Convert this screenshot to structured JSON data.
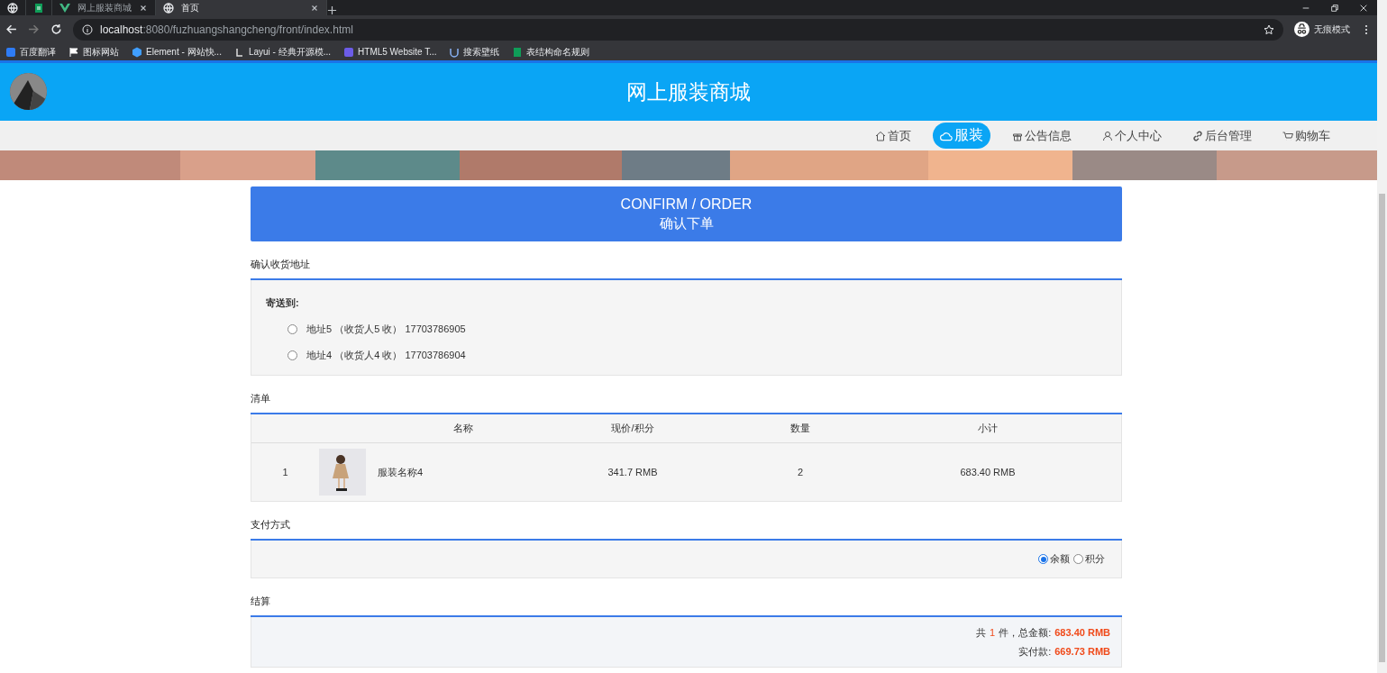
{
  "browser": {
    "tabs": [
      {
        "selected": false
      },
      {
        "selected": false
      },
      {
        "title": "网上服装商城",
        "selected": false
      },
      {
        "title": "首页",
        "selected": true
      }
    ],
    "url_host": "localhost",
    "url_rest": ":8080/fuzhuangshangcheng/front/index.html",
    "profile": "无痕模式",
    "bookmarks": [
      {
        "label": "百度翻译"
      },
      {
        "label": "图标网站"
      },
      {
        "label": "Element - 网站快..."
      },
      {
        "label": "Layui - 经典开源模..."
      },
      {
        "label": "HTML5 Website T..."
      },
      {
        "label": "搜索壁纸"
      },
      {
        "label": "表结构命名规则"
      }
    ]
  },
  "site": {
    "title": "网上服装商城",
    "nav": [
      {
        "label": "首页",
        "selected": false
      },
      {
        "label": "服装",
        "selected": true
      },
      {
        "label": "公告信息",
        "selected": false
      },
      {
        "label": "个人中心",
        "selected": false
      },
      {
        "label": "后台管理",
        "selected": false
      },
      {
        "label": "购物车",
        "selected": false
      }
    ]
  },
  "confirm": {
    "title_en": "CONFIRM / ORDER",
    "title_cn": "确认下单"
  },
  "address": {
    "heading": "确认收货地址",
    "label": "寄送到:",
    "options": [
      {
        "text": "地址5 （收货人5 收） 17703786905",
        "selected": false
      },
      {
        "text": "地址4 （收货人4 收） 17703786904",
        "selected": false
      }
    ]
  },
  "list": {
    "heading": "清单",
    "columns": [
      "名称",
      "现价/积分",
      "数量",
      "小计"
    ],
    "rows": [
      {
        "index": "1",
        "name": "服装名称4",
        "price": "341.7 RMB",
        "quantity": "2",
        "subtotal": "683.40 RMB"
      }
    ]
  },
  "payment": {
    "heading": "支付方式",
    "options": [
      {
        "label": "余额",
        "selected": true
      },
      {
        "label": "积分",
        "selected": false
      }
    ]
  },
  "settle": {
    "heading": "结算",
    "count_prefix": "共",
    "count": "1",
    "count_suffix": "件，总金额:",
    "total": "683.40 RMB",
    "paid_label": "实付款:",
    "paid": "669.73 RMB"
  }
}
